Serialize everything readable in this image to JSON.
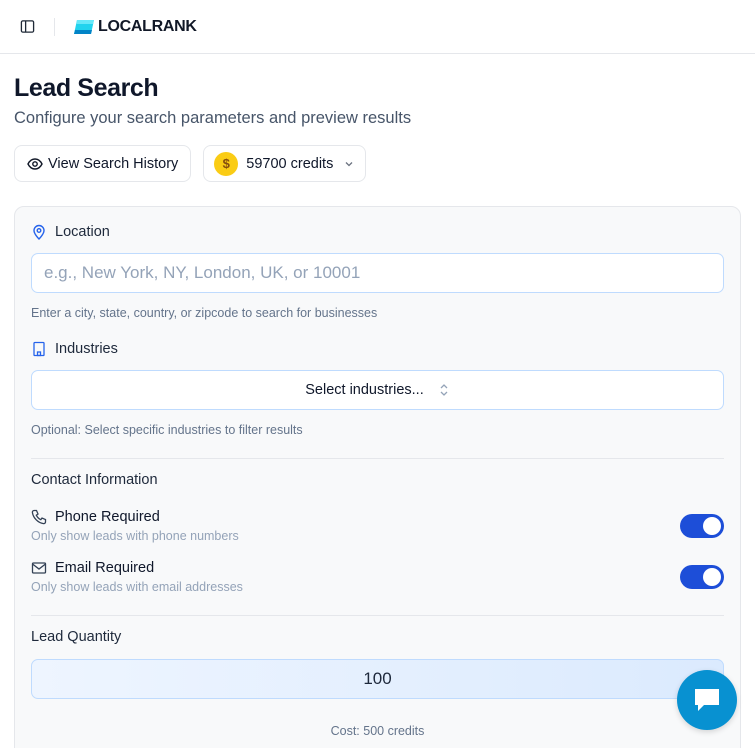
{
  "app": {
    "brand": "LOCALRANK"
  },
  "header": {
    "title": "Lead Search",
    "subtitle": "Configure your search parameters and preview results"
  },
  "actions": {
    "history_label": "View Search History",
    "credits_label": "59700 credits",
    "coin_symbol": "$"
  },
  "form": {
    "location": {
      "label": "Location",
      "placeholder": "e.g., New York, NY, London, UK, or 10001",
      "hint": "Enter a city, state, country, or zipcode to search for businesses"
    },
    "industries": {
      "label": "Industries",
      "select_text": "Select industries...",
      "hint": "Optional: Select specific industries to filter results"
    },
    "contact": {
      "title": "Contact Information",
      "phone": {
        "label": "Phone Required",
        "desc": "Only show leads with phone numbers",
        "on": true
      },
      "email": {
        "label": "Email Required",
        "desc": "Only show leads with email addresses",
        "on": true
      }
    },
    "quantity": {
      "title": "Lead Quantity",
      "value": "100",
      "cost": "Cost: 500 credits"
    }
  },
  "colors": {
    "accent": "#1d4ed8",
    "chat": "#0891d1",
    "coin": "#facc15"
  },
  "icons": [
    "sidebar-toggle-icon",
    "eye-icon",
    "coin-icon",
    "chevron-down-icon",
    "map-pin-icon",
    "building-icon",
    "chevrons-up-down-icon",
    "phone-icon",
    "mail-icon",
    "chat-icon"
  ]
}
